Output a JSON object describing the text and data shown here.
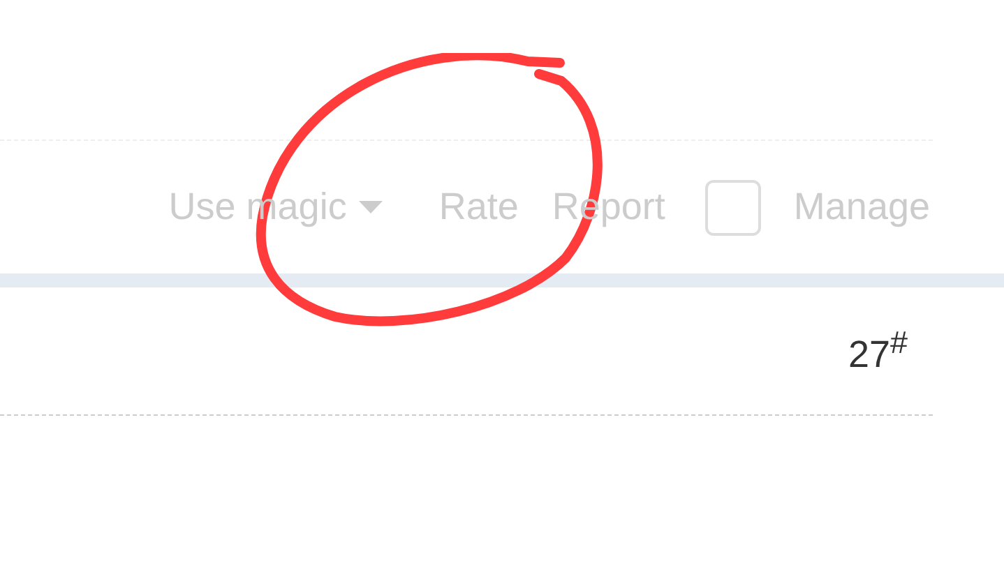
{
  "toolbar": {
    "use_magic": "Use magic",
    "rate": "Rate",
    "report": "Report",
    "manage_checkbox": {
      "checked": false
    },
    "manage": "Manage"
  },
  "row": {
    "value": "27$^{#}$"
  }
}
